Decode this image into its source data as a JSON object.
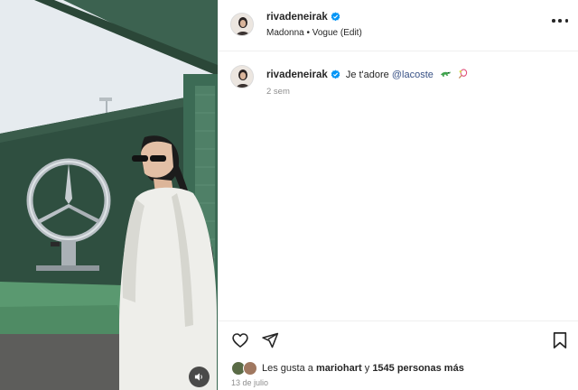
{
  "post": {
    "username": "rivadeneirak",
    "subtitle": "Madonna • Vogue (Edit)",
    "caption_text": "Je t'adore",
    "caption_mention": "@lacoste",
    "caption_emojis": [
      "crocodile-emoji",
      "tennis-racket-emoji"
    ],
    "time_ago": "2 sem",
    "likes_prefix": "Les gusta a",
    "likes_user": "mariohart",
    "likes_connector": "y",
    "likes_count_text": "1545 personas más",
    "date": "13 de julio"
  },
  "media": {
    "type": "video",
    "sound_icon": "speaker-icon"
  },
  "icons": {
    "verified": "verified-badge-icon",
    "more": "more-options-icon",
    "like": "heart-icon",
    "share": "paper-plane-icon",
    "save": "bookmark-icon"
  },
  "colors": {
    "verified_blue": "#0095f6",
    "mention_blue": "#385185",
    "muted_gray": "#8e8e8e",
    "text": "#262626"
  }
}
